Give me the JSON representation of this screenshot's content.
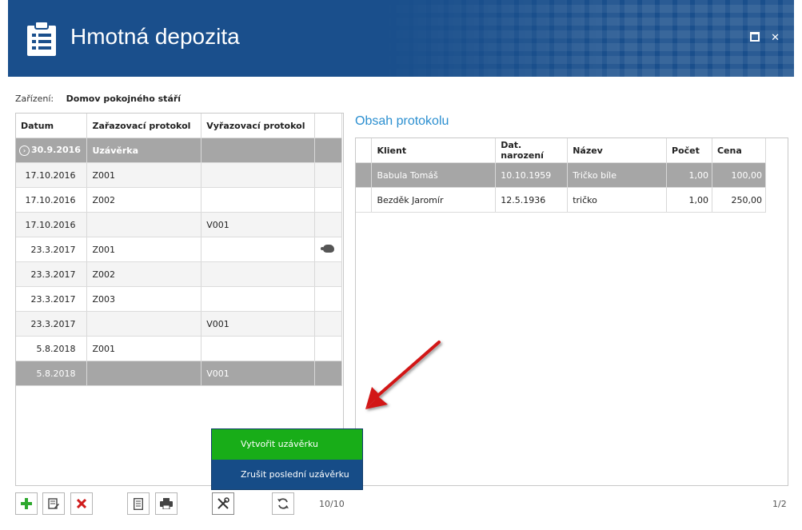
{
  "window": {
    "title": "Hmotná depozita",
    "maximize_label": "",
    "close_label": "✕"
  },
  "facility": {
    "label": "Zařízení:",
    "value": "Domov pokojného stáří"
  },
  "left_grid": {
    "headers": [
      "Datum",
      "Zařazovací protokol",
      "Vyřazovací protokol"
    ],
    "group_row": {
      "date": "30.9.2016",
      "label": "Uzávěrka"
    },
    "rows": [
      {
        "date": "17.10.2016",
        "in": "Z001",
        "out": ""
      },
      {
        "date": "17.10.2016",
        "in": "Z002",
        "out": ""
      },
      {
        "date": "17.10.2016",
        "in": "",
        "out": "V001"
      },
      {
        "date": "23.3.2017",
        "in": "Z001",
        "out": "",
        "icon": "piggy-bank-icon"
      },
      {
        "date": "23.3.2017",
        "in": "Z002",
        "out": ""
      },
      {
        "date": "23.3.2017",
        "in": "Z003",
        "out": ""
      },
      {
        "date": "23.3.2017",
        "in": "",
        "out": "V001"
      },
      {
        "date": "5.8.2018",
        "in": "Z001",
        "out": ""
      },
      {
        "date": "5.8.2018",
        "in": "",
        "out": "V001"
      }
    ],
    "counter": "10/10"
  },
  "right_panel": {
    "title": "Obsah protokolu",
    "headers": [
      "Klient",
      "Dat. narození",
      "Název",
      "Počet",
      "Cena"
    ],
    "rows": [
      {
        "client": "Babula Tomáš",
        "birth": "10.10.1959",
        "name": "Tričko bíle",
        "count": "1,00",
        "price": "100,00"
      },
      {
        "client": "Bezděk Jaromír",
        "birth": "12.5.1936",
        "name": "tričko",
        "count": "1,00",
        "price": "250,00"
      }
    ],
    "counter": "1/2"
  },
  "toolbar": {
    "icons": [
      "add-icon",
      "edit-icon",
      "delete-icon",
      "document-icon",
      "print-icon",
      "tools-icon",
      "refresh-icon"
    ]
  },
  "popup_menu": {
    "items": [
      "Vytvořit uzávěrku",
      "Zrušit poslední uzávěrku"
    ]
  },
  "colors": {
    "header_bg": "#1a4f8c",
    "accent": "#2b8fd0",
    "popup_bg": "#164c87",
    "popup_active": "#18ad18",
    "selected_row": "#a6a6a6"
  }
}
